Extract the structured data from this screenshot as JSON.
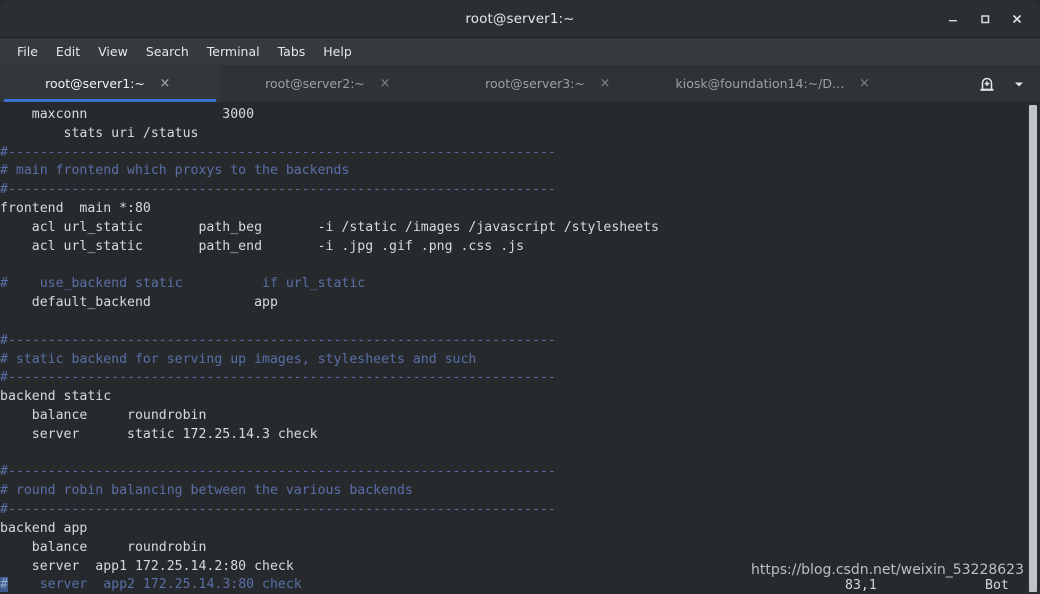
{
  "window": {
    "title": "root@server1:~",
    "controls": [
      {
        "name": "minimize",
        "label": "–"
      },
      {
        "name": "maximize",
        "label": "□"
      },
      {
        "name": "close",
        "label": "✕"
      }
    ]
  },
  "menubar": {
    "items": [
      "File",
      "Edit",
      "View",
      "Search",
      "Terminal",
      "Tabs",
      "Help"
    ]
  },
  "tabs": {
    "items": [
      {
        "label": "root@server1:~",
        "active": true,
        "close": "×"
      },
      {
        "label": "root@server2:~",
        "active": false,
        "close": "×"
      },
      {
        "label": "root@server3:~",
        "active": false,
        "close": "×"
      },
      {
        "label": "kiosk@foundation14:~/D…",
        "active": false,
        "close": "×"
      }
    ],
    "new_tab_icon": "new-tab-icon",
    "tab_list_icon": "chevron-down-icon"
  },
  "terminal": {
    "background": "#272a2d",
    "foreground": "#d7dadc",
    "comment_color": "#5a6ea8",
    "cursor_color": "#3f5b8c",
    "lines": [
      {
        "segments": [
          {
            "t": "    maxconn                 3000",
            "c": "text"
          }
        ]
      },
      {
        "segments": [
          {
            "t": "        stats uri /status",
            "c": "text"
          }
        ]
      },
      {
        "segments": [
          {
            "t": "#---------------------------------------------------------------------",
            "c": "comment"
          }
        ]
      },
      {
        "segments": [
          {
            "t": "# main frontend which proxys to the backends",
            "c": "comment"
          }
        ]
      },
      {
        "segments": [
          {
            "t": "#---------------------------------------------------------------------",
            "c": "comment"
          }
        ]
      },
      {
        "segments": [
          {
            "t": "frontend  main *:80",
            "c": "text"
          }
        ]
      },
      {
        "segments": [
          {
            "t": "    acl url_static       path_beg       -i /static /images /javascript /stylesheets",
            "c": "text"
          }
        ]
      },
      {
        "segments": [
          {
            "t": "    acl url_static       path_end       -i .jpg .gif .png .css .js",
            "c": "text"
          }
        ]
      },
      {
        "segments": [
          {
            "t": "",
            "c": "text"
          }
        ]
      },
      {
        "segments": [
          {
            "t": "#    use_backend static          if url_static",
            "c": "comment"
          }
        ]
      },
      {
        "segments": [
          {
            "t": "    default_backend             app",
            "c": "text"
          }
        ]
      },
      {
        "segments": [
          {
            "t": "",
            "c": "text"
          }
        ]
      },
      {
        "segments": [
          {
            "t": "#---------------------------------------------------------------------",
            "c": "comment"
          }
        ]
      },
      {
        "segments": [
          {
            "t": "# static backend for serving up images, stylesheets and such",
            "c": "comment"
          }
        ]
      },
      {
        "segments": [
          {
            "t": "#---------------------------------------------------------------------",
            "c": "comment"
          }
        ]
      },
      {
        "segments": [
          {
            "t": "backend static",
            "c": "text"
          }
        ]
      },
      {
        "segments": [
          {
            "t": "    balance     roundrobin",
            "c": "text"
          }
        ]
      },
      {
        "segments": [
          {
            "t": "    server      static 172.25.14.3 check",
            "c": "text"
          }
        ]
      },
      {
        "segments": [
          {
            "t": "",
            "c": "text"
          }
        ]
      },
      {
        "segments": [
          {
            "t": "#---------------------------------------------------------------------",
            "c": "comment"
          }
        ]
      },
      {
        "segments": [
          {
            "t": "# round robin balancing between the various backends",
            "c": "comment"
          }
        ]
      },
      {
        "segments": [
          {
            "t": "#---------------------------------------------------------------------",
            "c": "comment"
          }
        ]
      },
      {
        "segments": [
          {
            "t": "backend app",
            "c": "text"
          }
        ]
      },
      {
        "segments": [
          {
            "t": "    balance     roundrobin",
            "c": "text"
          }
        ]
      },
      {
        "segments": [
          {
            "t": "    server  app1 172.25.14.2:80 check",
            "c": "text"
          }
        ]
      },
      {
        "segments": [
          {
            "t": "#",
            "c": "cursor"
          },
          {
            "t": "    server  app2 172.25.14.3:80 check",
            "c": "comment"
          }
        ]
      }
    ],
    "statusline": {
      "position": "83,1",
      "scroll": "Bot"
    },
    "scrollbar": "vertical-scrollbar"
  },
  "watermark": {
    "text": "https://blog.csdn.net/weixin_53228623"
  }
}
